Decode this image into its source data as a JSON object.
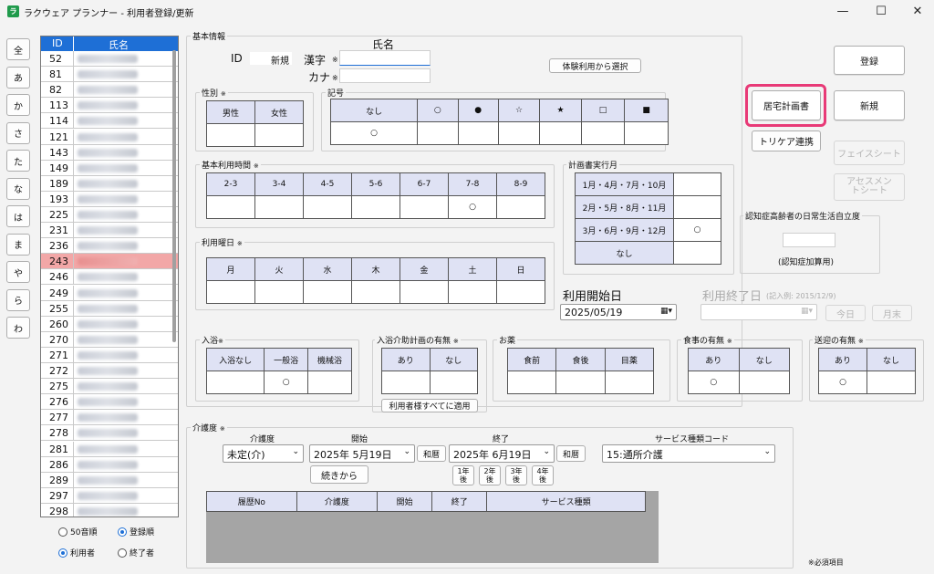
{
  "window": {
    "title": "ラクウェア プランナー - 利用者登録/更新",
    "app_icon": "ラ",
    "minimize": "—",
    "maximize": "☐",
    "close": "✕"
  },
  "kana_buttons": [
    "全",
    "あ",
    "か",
    "さ",
    "た",
    "な",
    "は",
    "ま",
    "や",
    "ら",
    "わ"
  ],
  "list": {
    "headers": {
      "id": "ID",
      "name": "氏名"
    },
    "rows": [
      "52",
      "81",
      "82",
      "113",
      "114",
      "121",
      "143",
      "149",
      "189",
      "193",
      "225",
      "231",
      "236",
      "243",
      "246",
      "249",
      "255",
      "260",
      "270",
      "271",
      "272",
      "275",
      "276",
      "277",
      "278",
      "281",
      "286",
      "289",
      "297",
      "298"
    ],
    "selected_id": "243"
  },
  "sort_options": {
    "kana": "50音順",
    "registered": "登録順",
    "user": "利用者",
    "ended": "終了者"
  },
  "basic": {
    "section": "基本情報",
    "id_label": "ID",
    "id_value": "新規",
    "name_title": "氏名",
    "kanji_label": "漢字",
    "kana_label": "カナ",
    "required_mark": "※",
    "trial_button": "体験利用から選択"
  },
  "gender": {
    "label": "性別",
    "options": [
      "男性",
      "女性"
    ]
  },
  "symbol": {
    "label": "記号",
    "options": [
      "なし",
      "○",
      "●",
      "☆",
      "★",
      "□",
      "■"
    ],
    "selected_marks": [
      "○",
      "",
      "",
      "",
      "",
      "",
      ""
    ]
  },
  "time": {
    "label": "基本利用時間",
    "options": [
      "2-3",
      "3-4",
      "4-5",
      "5-6",
      "6-7",
      "7-8",
      "8-9"
    ],
    "marks": [
      "",
      "",
      "",
      "",
      "",
      "○",
      ""
    ]
  },
  "plan_month": {
    "label": "計画書実行月",
    "rows": [
      "1月・4月・7月・10月",
      "2月・5月・8月・11月",
      "3月・6月・9月・12月",
      "なし"
    ],
    "marks": [
      "",
      "",
      "○",
      ""
    ]
  },
  "days": {
    "label": "利用曜日",
    "options": [
      "月",
      "火",
      "水",
      "木",
      "金",
      "土",
      "日"
    ]
  },
  "start": {
    "label": "利用開始日",
    "value": "2025/05/19"
  },
  "end": {
    "label": "利用終了日",
    "example": "(記入例: 2015/12/9)",
    "today": "今日",
    "month_end": "月末"
  },
  "dementia": {
    "label": "認知症高齢者の日常生活自立度",
    "note": "(認知症加算用)"
  },
  "bath": {
    "label": "入浴",
    "options": [
      "入浴なし",
      "一般浴",
      "機械浴"
    ],
    "marks": [
      "",
      "○",
      ""
    ]
  },
  "bath_plan": {
    "label": "入浴介助計画の有無",
    "options": [
      "あり",
      "なし"
    ],
    "apply_all": "利用者様すべてに適用"
  },
  "medicine": {
    "label": "お薬",
    "options": [
      "食前",
      "食後",
      "目薬"
    ]
  },
  "meal": {
    "label": "食事の有無",
    "options": [
      "あり",
      "なし"
    ],
    "marks": [
      "○",
      ""
    ]
  },
  "transport": {
    "label": "送迎の有無",
    "options": [
      "あり",
      "なし"
    ],
    "marks": [
      "○",
      ""
    ]
  },
  "care": {
    "section": "介護度",
    "level_label": "介護度",
    "level_value": "未定(介)",
    "start_label": "開始",
    "start_value": "2025年 5月19日",
    "end_label": "終了",
    "end_value": "2025年 6月19日",
    "wareki": "和暦",
    "service_label": "サービス種類コード",
    "service_value": "15:通所介護",
    "continue": "続きから",
    "years": [
      "1年後",
      "2年後",
      "3年後",
      "4年後"
    ],
    "history_headers": [
      "履歴No",
      "介護度",
      "開始",
      "終了",
      "サービス種類"
    ]
  },
  "buttons": {
    "register": "登録",
    "home_plan": "居宅計画書",
    "new": "新規",
    "toricare": "トリケア連携",
    "face_sheet": "フェイスシート",
    "assessment": "アセスメントシート"
  },
  "footer_note": "※必須項目",
  "colors": {
    "accent": "#1e6fd6",
    "highlight": "#e83a77",
    "selected_row": "#f2a7a7"
  }
}
